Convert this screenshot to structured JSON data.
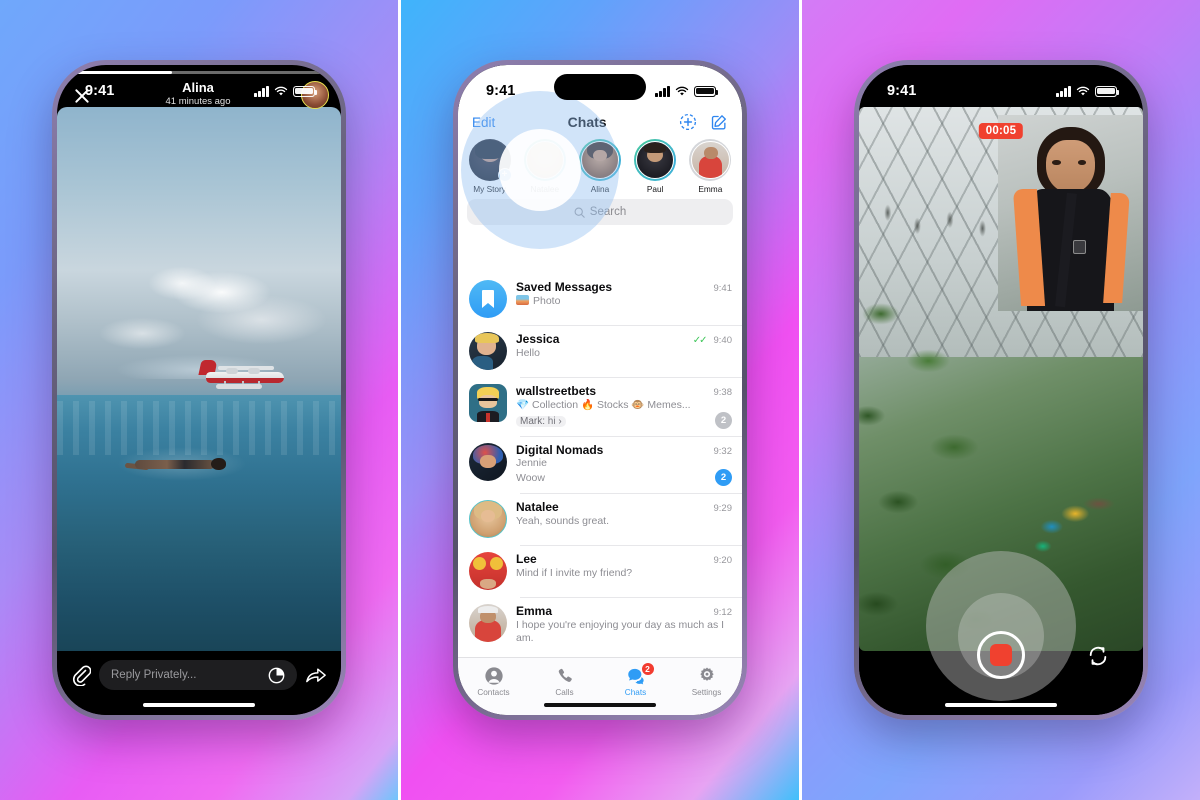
{
  "panels": [
    {
      "status": {
        "time": "9:41",
        "signal_icon": "cellular-bars-icon",
        "wifi_icon": "wifi-icon",
        "battery_icon": "battery-icon"
      },
      "story": {
        "name": "Alina",
        "timestamp": "41 minutes ago",
        "close_icon": "close-icon",
        "avatar_name": "story-author-avatar",
        "progress_percent": 40,
        "reply": {
          "placeholder": "Reply Privately...",
          "attach_icon": "paperclip-icon",
          "sticker_icon": "pie-sticker-icon",
          "share_icon": "share-arrow-icon"
        }
      }
    },
    {
      "status": {
        "time": "9:41"
      },
      "nav": {
        "edit_label": "Edit",
        "title": "Chats",
        "add_story_icon": "add-story-icon",
        "compose_icon": "compose-icon"
      },
      "stories": [
        {
          "label": "My Story",
          "ring": "none",
          "has_plus": true
        },
        {
          "label": "Natalee",
          "ring": "on",
          "has_plus": false
        },
        {
          "label": "Alina",
          "ring": "on",
          "has_plus": false
        },
        {
          "label": "Paul",
          "ring": "on",
          "has_plus": false
        },
        {
          "label": "Emma",
          "ring": "off",
          "has_plus": false
        }
      ],
      "search": {
        "placeholder": "Search",
        "icon": "search-icon"
      },
      "chats": [
        {
          "name": "Saved Messages",
          "message": "Photo",
          "time": "9:41",
          "avatar": "bookmark-avatar",
          "badge": "",
          "ticks": false,
          "thumb": true
        },
        {
          "name": "Jessica",
          "message": "Hello",
          "time": "9:40",
          "avatar": "jessica-avatar",
          "badge": "",
          "ticks": true
        },
        {
          "name": "wallstreetbets",
          "message": "💎 Collection  🔥 Stocks  🐵 Memes...",
          "sender": "Mark:",
          "reply_preview": "hi",
          "time": "9:38",
          "avatar": "wallstreetbets-avatar",
          "badge": "2",
          "badge_color": "gray"
        },
        {
          "name": "Digital Nomads",
          "sender_line": "Jennie",
          "message": "Woow",
          "time": "9:32",
          "avatar": "digital-nomads-avatar",
          "badge": "2",
          "badge_color": "blue"
        },
        {
          "name": "Natalee",
          "message": "Yeah, sounds great.",
          "time": "9:29",
          "avatar": "natalee-avatar",
          "badge": "",
          "ringed": true
        },
        {
          "name": "Lee",
          "message": "Mind if I invite my friend?",
          "time": "9:20",
          "avatar": "lee-avatar",
          "badge": ""
        },
        {
          "name": "Emma",
          "message": "I hope you're enjoying your day as much as I am.",
          "time": "9:12",
          "avatar": "emma-avatar",
          "badge": ""
        }
      ],
      "tabs": [
        {
          "label": "Contacts",
          "icon": "contacts-icon",
          "active": false,
          "badge": ""
        },
        {
          "label": "Calls",
          "icon": "phone-icon",
          "active": false,
          "badge": ""
        },
        {
          "label": "Chats",
          "icon": "chats-icon",
          "active": true,
          "badge": "2"
        },
        {
          "label": "Settings",
          "icon": "gear-icon",
          "active": false,
          "badge": ""
        }
      ]
    },
    {
      "status": {
        "time": "9:41"
      },
      "camera": {
        "timer": "00:05",
        "record_icon": "record-stop-button",
        "flip_icon": "flip-camera-icon",
        "pip_name": "selfie-pip-preview"
      }
    }
  ],
  "colors": {
    "accent_blue": "#2f9cf5",
    "record_red": "#f0412f",
    "badge_red": "#f23b30",
    "tick_green": "#3fc65a",
    "story_ring": "#3fb8c8"
  }
}
